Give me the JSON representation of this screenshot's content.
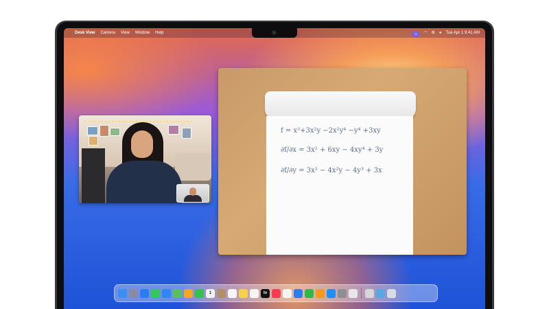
{
  "menubar": {
    "app_name": "Desk View",
    "items": [
      "Camera",
      "View",
      "Window",
      "Help"
    ],
    "datetime": "Tue Apr 1  9:41 AM"
  },
  "desk_view": {
    "equations": [
      "f = x³+3x²y −2x²y⁴ −y⁴ +3xy",
      "∂f/∂x = 3x² + 6xy − 4xy⁴ + 3y",
      "∂f/∂y = 3x² − 4x²y − 4y³ + 3x"
    ]
  },
  "dock": {
    "apps": [
      {
        "name": "finder-icon",
        "color": "#3a8ef0"
      },
      {
        "name": "launchpad-icon",
        "color": "#8a8aa0"
      },
      {
        "name": "safari-icon",
        "color": "#2a7df0"
      },
      {
        "name": "messages-icon",
        "color": "#34c759"
      },
      {
        "name": "mail-icon",
        "color": "#2f86f5"
      },
      {
        "name": "maps-icon",
        "color": "#5ac05a"
      },
      {
        "name": "photos-icon",
        "color": "#f5a623"
      },
      {
        "name": "facetime-icon",
        "color": "#33c24d"
      },
      {
        "name": "calendar-icon",
        "color": "#f2f2f2"
      },
      {
        "name": "contacts-icon",
        "color": "#b0906a"
      },
      {
        "name": "reminders-icon",
        "color": "#f5f5f5"
      },
      {
        "name": "notes-icon",
        "color": "#f7d14c"
      },
      {
        "name": "freeform-icon",
        "color": "#f5f5f5"
      },
      {
        "name": "tv-icon",
        "color": "#111111"
      },
      {
        "name": "music-icon",
        "color": "#fa3c52"
      },
      {
        "name": "news-icon",
        "color": "#f4f4f4"
      },
      {
        "name": "keynote-icon",
        "color": "#2b7ef0"
      },
      {
        "name": "numbers-icon",
        "color": "#2fb84a"
      },
      {
        "name": "pages-icon",
        "color": "#f39a1d"
      },
      {
        "name": "app-store-icon",
        "color": "#1e8ff5"
      },
      {
        "name": "system-settings-icon",
        "color": "#8e8e93"
      },
      {
        "name": "iphone-mirroring-icon",
        "color": "#e8e8ea"
      },
      {
        "name": "preview-icon",
        "color": "#d7d7d9"
      },
      {
        "name": "downloads-folder-icon",
        "color": "#5aa7e6"
      },
      {
        "name": "trash-icon",
        "color": "#d9dde3"
      }
    ],
    "calendar_day": "1",
    "tv_label": "tv"
  }
}
